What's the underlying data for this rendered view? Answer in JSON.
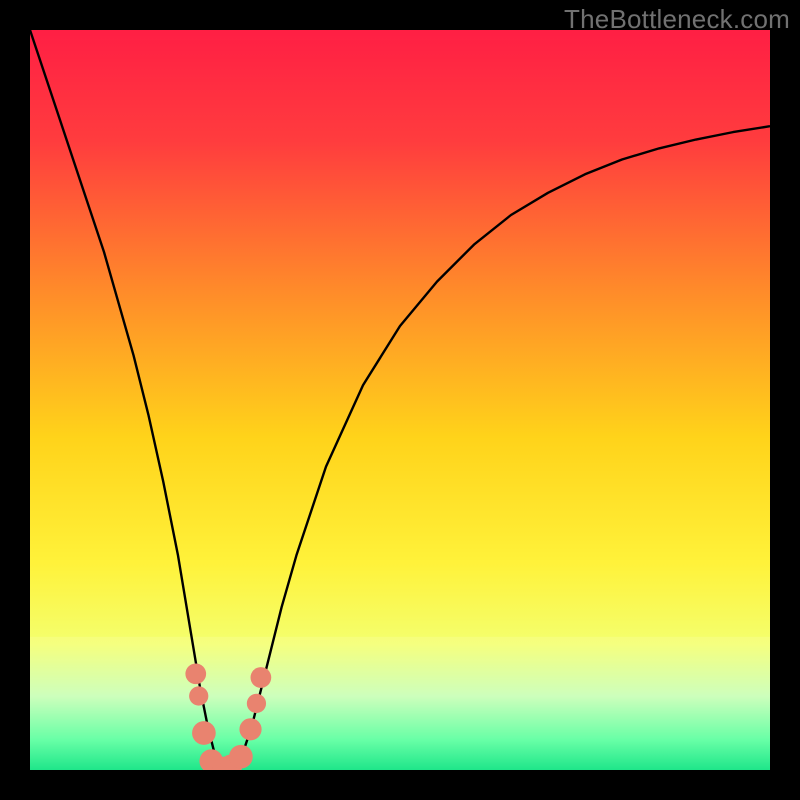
{
  "watermark": "TheBottleneck.com",
  "chart_data": {
    "type": "line",
    "title": "",
    "xlabel": "",
    "ylabel": "",
    "xlim": [
      0,
      100
    ],
    "ylim": [
      0,
      100
    ],
    "background_gradient": {
      "stops": [
        {
          "offset": 0.0,
          "color": "#ff1f44"
        },
        {
          "offset": 0.15,
          "color": "#ff3c3e"
        },
        {
          "offset": 0.35,
          "color": "#ff8a2a"
        },
        {
          "offset": 0.55,
          "color": "#ffd31a"
        },
        {
          "offset": 0.72,
          "color": "#fff23a"
        },
        {
          "offset": 0.83,
          "color": "#f4ff6e"
        },
        {
          "offset": 0.9,
          "color": "#c7ffb3"
        },
        {
          "offset": 0.96,
          "color": "#52ff9a"
        },
        {
          "offset": 1.0,
          "color": "#00e37a"
        }
      ]
    },
    "series": [
      {
        "name": "bottleneck-curve",
        "x": [
          0,
          2,
          4,
          6,
          8,
          10,
          12,
          14,
          16,
          18,
          20,
          22,
          23,
          24,
          25,
          26,
          27,
          28,
          29,
          30,
          32,
          34,
          36,
          40,
          45,
          50,
          55,
          60,
          65,
          70,
          75,
          80,
          85,
          90,
          95,
          100
        ],
        "y": [
          100,
          94,
          88,
          82,
          76,
          70,
          63,
          56,
          48,
          39,
          29,
          17,
          11,
          6,
          2,
          0,
          0,
          1,
          3,
          6,
          14,
          22,
          29,
          41,
          52,
          60,
          66,
          71,
          75,
          78,
          80.5,
          82.5,
          84,
          85.2,
          86.2,
          87
        ]
      }
    ],
    "markers": [
      {
        "x": 22.4,
        "y": 13.0,
        "r": 1.4
      },
      {
        "x": 22.8,
        "y": 10.0,
        "r": 1.3
      },
      {
        "x": 23.5,
        "y": 5.0,
        "r": 1.6
      },
      {
        "x": 24.5,
        "y": 1.2,
        "r": 1.6
      },
      {
        "x": 25.2,
        "y": 0.4,
        "r": 1.4
      },
      {
        "x": 26.2,
        "y": 0.3,
        "r": 1.5
      },
      {
        "x": 27.2,
        "y": 0.6,
        "r": 1.5
      },
      {
        "x": 28.5,
        "y": 1.8,
        "r": 1.6
      },
      {
        "x": 29.8,
        "y": 5.5,
        "r": 1.5
      },
      {
        "x": 30.6,
        "y": 9.0,
        "r": 1.3
      },
      {
        "x": 31.2,
        "y": 12.5,
        "r": 1.4
      }
    ],
    "marker_color": "#e9836f",
    "highlight_band": {
      "y0": 0,
      "y1": 18,
      "color": "rgba(255,255,255,0.12)"
    }
  }
}
